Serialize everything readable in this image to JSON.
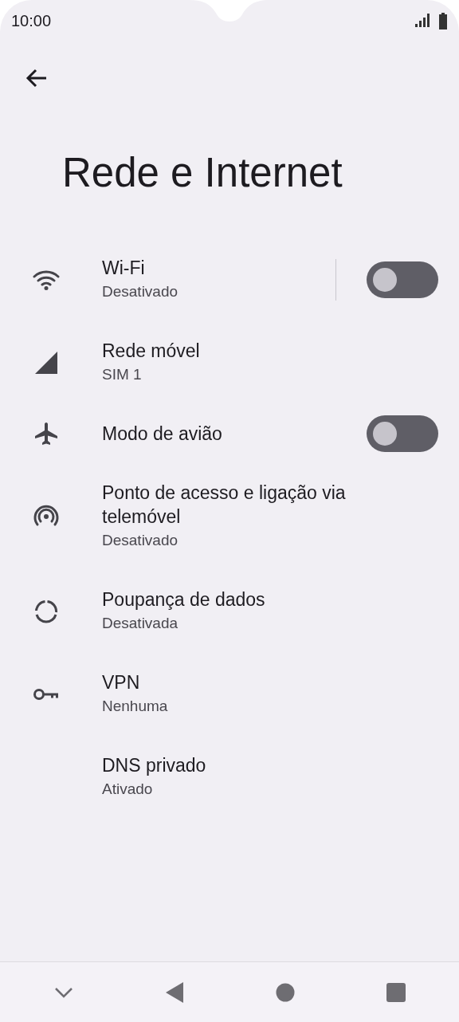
{
  "status_bar": {
    "time": "10:00"
  },
  "header": {
    "title": "Rede e Internet"
  },
  "items": [
    {
      "kind": "split-toggle",
      "title": "Wi-Fi",
      "subtitle": "Desativado",
      "on": false
    },
    {
      "kind": "plain",
      "title": "Rede móvel",
      "subtitle": "SIM 1"
    },
    {
      "kind": "toggle",
      "title": "Modo de avião",
      "on": false
    },
    {
      "kind": "plain",
      "title": "Ponto de acesso e ligação via telemóvel",
      "subtitle": "Desativado"
    },
    {
      "kind": "plain",
      "title": "Poupança de dados",
      "subtitle": "Desativada"
    },
    {
      "kind": "plain",
      "title": "VPN",
      "subtitle": "Nenhuma"
    },
    {
      "kind": "plain",
      "title": "DNS privado",
      "subtitle": "Ativado"
    }
  ]
}
